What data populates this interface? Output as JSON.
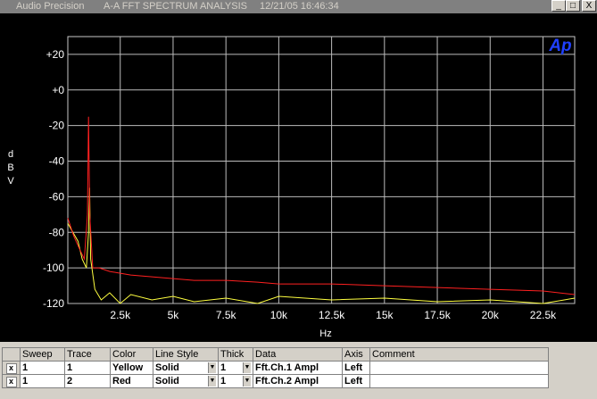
{
  "window": {
    "app": "Audio Precision",
    "title": "A-A FFT SPECTRUM ANALYSIS",
    "datetime": "12/21/05 16:46:34",
    "controls": [
      "_",
      "□",
      "X"
    ]
  },
  "logo_text": "Ap",
  "chart_data": {
    "type": "line",
    "xlabel": "Hz",
    "ylabel": "dBV",
    "ylabel_chars": [
      "d",
      "B",
      "V"
    ],
    "xlim": [
      20,
      24000
    ],
    "ylim": [
      -120,
      30
    ],
    "x_ticks": [
      2500,
      5000,
      7500,
      10000,
      12500,
      15000,
      17500,
      20000,
      22500
    ],
    "x_tick_labels": [
      "2.5k",
      "5k",
      "7.5k",
      "10k",
      "12.5k",
      "15k",
      "17.5k",
      "20k",
      "22.5k"
    ],
    "y_ticks": [
      20,
      0,
      -20,
      -40,
      -60,
      -80,
      -100,
      -120
    ],
    "y_tick_labels": [
      "+20",
      "+0",
      "-20",
      "-40",
      "-60",
      "-80",
      "-100",
      "-120"
    ],
    "grid": true,
    "series": [
      {
        "color": "#ffff40",
        "x": [
          20,
          500,
          700,
          900,
          1000,
          1050,
          1100,
          1300,
          1600,
          2000,
          2500,
          3000,
          4000,
          5000,
          6000,
          7500,
          9000,
          10000,
          12500,
          15000,
          17500,
          20000,
          22500,
          24000
        ],
        "y": [
          -75,
          -85,
          -95,
          -100,
          -80,
          -55,
          -95,
          -112,
          -118,
          -114,
          -120,
          -115,
          -118,
          -116,
          -119,
          -117,
          -120,
          -116,
          -118,
          -117,
          -119,
          -118,
          -120,
          -117
        ]
      },
      {
        "color": "#ff2020",
        "x": [
          20,
          300,
          600,
          800,
          950,
          1000,
          1020,
          1060,
          1200,
          1500,
          2000,
          2500,
          3000,
          4000,
          5000,
          6000,
          7500,
          9000,
          10000,
          12500,
          15000,
          17500,
          20000,
          22500,
          24000
        ],
        "y": [
          -72,
          -82,
          -90,
          -95,
          -70,
          -15,
          -35,
          -70,
          -100,
          -100,
          -102,
          -103,
          -104,
          -105,
          -106,
          -107,
          -107,
          -108,
          -109,
          -109,
          -110,
          -111,
          -112,
          -113,
          -115
        ]
      }
    ]
  },
  "trace_table": {
    "headers": [
      "Sweep",
      "Trace",
      "Color",
      "Line Style",
      "Thick",
      "Data",
      "Axis",
      "Comment"
    ],
    "rows": [
      {
        "checked": "x",
        "sweep": "1",
        "trace": "1",
        "color": "Yellow",
        "style": "Solid",
        "thick": "1",
        "data": "Fft.Ch.1 Ampl",
        "axis": "Left",
        "comment": ""
      },
      {
        "checked": "x",
        "sweep": "1",
        "trace": "2",
        "color": "Red",
        "style": "Solid",
        "thick": "1",
        "data": "Fft.Ch.2 Ampl",
        "axis": "Left",
        "comment": ""
      }
    ]
  }
}
